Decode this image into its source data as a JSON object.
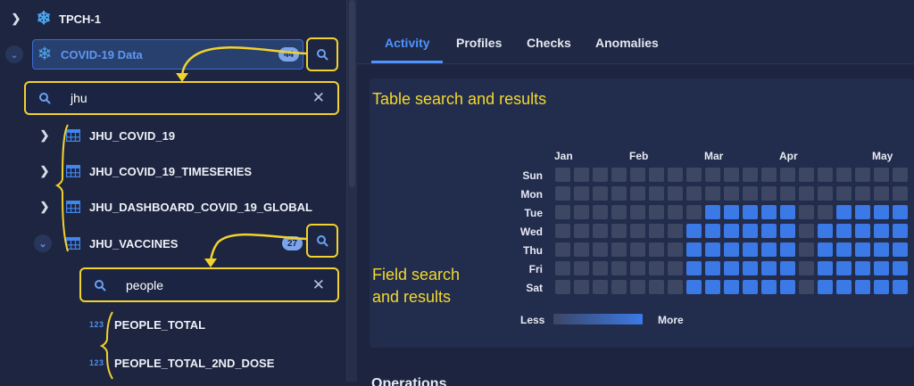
{
  "sidebar": {
    "tree": {
      "tpch_label": "TPCH-1",
      "covid_label": "COVID-19 Data",
      "covid_count": "44",
      "table_search_value": "jhu",
      "tables": [
        {
          "label": "JHU_COVID_19"
        },
        {
          "label": "JHU_COVID_19_TIMESERIES"
        },
        {
          "label": "JHU_DASHBOARD_COVID_19_GLOBAL"
        },
        {
          "label": "JHU_VACCINES",
          "count": "27"
        }
      ],
      "field_search_value": "people",
      "fields": [
        {
          "type_icon": "123",
          "label": "PEOPLE_TOTAL"
        },
        {
          "type_icon": "123",
          "label": "PEOPLE_TOTAL_2ND_DOSE"
        }
      ]
    }
  },
  "main": {
    "tabs": [
      {
        "label": "Activity",
        "active": true
      },
      {
        "label": "Profiles",
        "active": false
      },
      {
        "label": "Checks",
        "active": false
      },
      {
        "label": "Anomalies",
        "active": false
      }
    ],
    "annotations": {
      "table_search": "Table search and results",
      "field_search_line1": "Field search",
      "field_search_line2": "and results"
    },
    "heatmap": {
      "months": [
        "Jan",
        "Feb",
        "Mar",
        "Apr",
        "May"
      ],
      "days": [
        "Sun",
        "Mon",
        "Tue",
        "Wed",
        "Thu",
        "Fri",
        "Sat"
      ],
      "legend_less": "Less",
      "legend_more": "More",
      "grid": [
        [
          0,
          0,
          0,
          0,
          0,
          0,
          0,
          0,
          0,
          0,
          0,
          0,
          0,
          0,
          0,
          0,
          0,
          0,
          0,
          0
        ],
        [
          0,
          0,
          0,
          0,
          0,
          0,
          0,
          0,
          0,
          0,
          0,
          0,
          0,
          0,
          0,
          0,
          0,
          0,
          0,
          0
        ],
        [
          0,
          0,
          0,
          0,
          0,
          0,
          0,
          0,
          1,
          1,
          1,
          1,
          1,
          0,
          0,
          1,
          1,
          1,
          1,
          0
        ],
        [
          0,
          0,
          0,
          0,
          0,
          0,
          0,
          1,
          1,
          1,
          1,
          1,
          1,
          0,
          1,
          1,
          1,
          1,
          1,
          0
        ],
        [
          0,
          0,
          0,
          0,
          0,
          0,
          0,
          1,
          1,
          1,
          1,
          1,
          1,
          0,
          1,
          1,
          1,
          1,
          1,
          0
        ],
        [
          0,
          0,
          0,
          0,
          0,
          0,
          0,
          1,
          1,
          1,
          1,
          1,
          1,
          0,
          1,
          1,
          1,
          1,
          1,
          0
        ],
        [
          0,
          0,
          0,
          0,
          0,
          0,
          0,
          1,
          1,
          1,
          1,
          1,
          1,
          0,
          1,
          1,
          1,
          1,
          1,
          1
        ]
      ],
      "colors": {
        "empty": "#3d4663",
        "active": "#3b79e6"
      }
    },
    "bottom_title": "Operations"
  },
  "colors": {
    "background": "#1d2540",
    "accent": "#4f93ff",
    "annotation": "#f2d92e"
  }
}
